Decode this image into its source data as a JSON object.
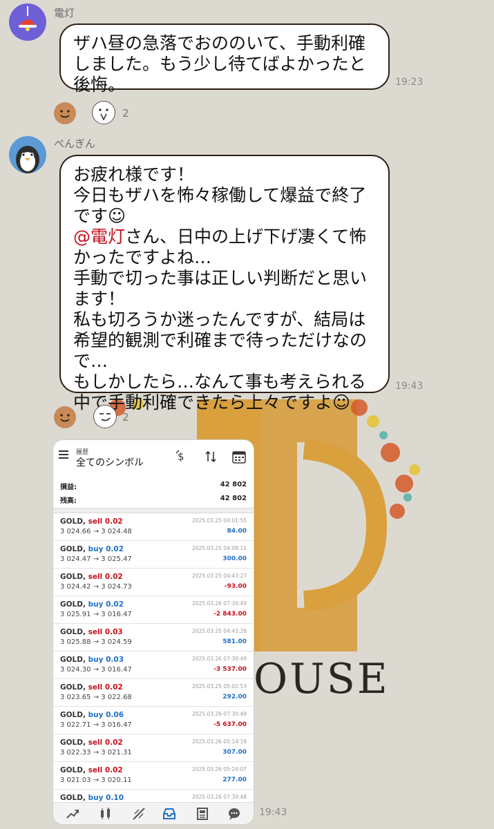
{
  "colors": {
    "background": "#dcd9d1",
    "mention": "#c6101b",
    "profit_pos": "#1f6fc7",
    "profit_neg": "#c6101b"
  },
  "watermark": {
    "text": "OUSE"
  },
  "messages": [
    {
      "sender": "電灯",
      "avatar_icon": "ceiling-lamp-icon",
      "lines": [
        "ザハ昼の急落でおののいて、手動利確",
        "しました。もう少し待てばよかったと",
        "後悔。"
      ],
      "time": "19:23",
      "reactions": {
        "icons": [
          "smile-face-icon",
          "praying-face-icon"
        ],
        "count": "2"
      }
    },
    {
      "sender": "ぺんぎん",
      "avatar_icon": "penguin-icon",
      "lines": [
        "お疲れ様です！",
        "今日もザハを怖々稼働して爆益で終了",
        "です☺",
        "さん、日中の上げ下げ凄くて怖",
        "かったですよね…",
        "手動で切った事は正しい判断だと思い",
        "ます！",
        "私も切ろうか迷ったんですが、結局は",
        "希望的観測で利確まで待っただけなの",
        "で…",
        "もしかしたら…なんて事も考えられる",
        "中で手動利確できたら上々ですよ☺"
      ],
      "mention": "@電灯",
      "time": "19:43",
      "reactions": {
        "icons": [
          "smile-face-icon",
          "smug-face-icon"
        ],
        "count": "2"
      }
    }
  ],
  "image_message": {
    "time": "19:43",
    "header": {
      "sub": "履歴",
      "title": "全てのシンボル",
      "icons": [
        "currency-icon",
        "sort-icon",
        "calendar-icon"
      ]
    },
    "summary": [
      {
        "label": "損益:",
        "value": "42 802"
      },
      {
        "label": "残高:",
        "value": "42 802"
      }
    ],
    "trades": [
      {
        "symbol": "GOLD,",
        "side": "sell 0.02",
        "dir": "sell",
        "prices": "3 024.66 → 3 024.48",
        "time": "2025.03.25 04:01:55",
        "profit": "84.00",
        "sign": "pos"
      },
      {
        "symbol": "GOLD,",
        "side": "buy 0.02",
        "dir": "buy",
        "prices": "3 024.47 → 3 025.47",
        "time": "2025.03.25 04:08:11",
        "profit": "300.00",
        "sign": "pos"
      },
      {
        "symbol": "GOLD,",
        "side": "sell 0.02",
        "dir": "sell",
        "prices": "3 024.42 → 3 024.73",
        "time": "2025.03.25 04:43:27",
        "profit": "-93.00",
        "sign": "neg"
      },
      {
        "symbol": "GOLD,",
        "side": "buy 0.02",
        "dir": "buy",
        "prices": "3 025.91 → 3 016.47",
        "time": "2025.03.26 07:30:49",
        "profit": "-2 843.00",
        "sign": "neg"
      },
      {
        "symbol": "GOLD,",
        "side": "sell 0.03",
        "dir": "sell",
        "prices": "3 025.88 → 3 024.59",
        "time": "2025.03.25 04:43:26",
        "profit": "581.00",
        "sign": "pos"
      },
      {
        "symbol": "GOLD,",
        "side": "buy 0.03",
        "dir": "buy",
        "prices": "3 024.30 → 3 016.47",
        "time": "2025.03.26 07:30:49",
        "profit": "-3 537.00",
        "sign": "neg"
      },
      {
        "symbol": "GOLD,",
        "side": "sell 0.02",
        "dir": "sell",
        "prices": "3 023.65 → 3 022.68",
        "time": "2025.03.25 05:02:53",
        "profit": "292.00",
        "sign": "pos"
      },
      {
        "symbol": "GOLD,",
        "side": "buy 0.06",
        "dir": "buy",
        "prices": "3 022.71 → 3 016.47",
        "time": "2025.03.26 07:30:49",
        "profit": "-5 637.00",
        "sign": "neg"
      },
      {
        "symbol": "GOLD,",
        "side": "sell 0.02",
        "dir": "sell",
        "prices": "3 022.33 → 3 021.31",
        "time": "2025.03.26 05:14:19",
        "profit": "307.00",
        "sign": "pos"
      },
      {
        "symbol": "GOLD,",
        "side": "sell 0.02",
        "dir": "sell",
        "prices": "3 021.03 → 3 020.11",
        "time": "2025.03.26 05:24:07",
        "profit": "277.00",
        "sign": "pos"
      },
      {
        "symbol": "GOLD,",
        "side": "buy 0.10",
        "dir": "buy",
        "prices": "",
        "time": "2025.03.26 07:30:48",
        "profit": "",
        "sign": "pos"
      }
    ],
    "nav_icons": [
      "quotes-icon",
      "chart-icon",
      "trade-icon",
      "history-icon",
      "news-icon",
      "chat-icon"
    ]
  }
}
